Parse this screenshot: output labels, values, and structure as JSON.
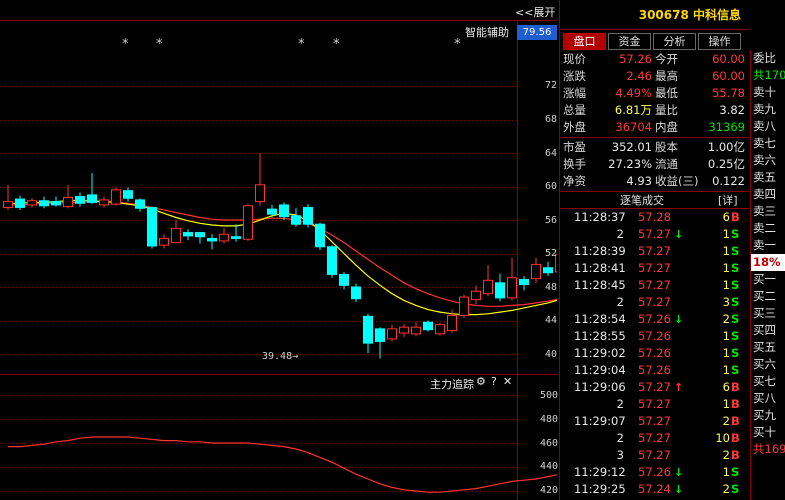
{
  "chart": {
    "collapse_link": "<<展开",
    "smart_label": "智能辅助",
    "current_price_tag": "79.56",
    "y_labels": [
      "72",
      "68",
      "64",
      "60",
      "56",
      "52",
      "48",
      "44",
      "40"
    ],
    "low_marker": "39.48→",
    "sub_title": "主力追踪",
    "sub_gear_icon": "⚙",
    "sub_help_icon": "?",
    "sub_close_icon": "✕",
    "sub_y_labels": [
      "500",
      "480",
      "460",
      "440",
      "420"
    ],
    "star_glyph": "*",
    "colors": {
      "up": "#ff3232",
      "down": "#00ffff",
      "ma_yellow": "#ffff00",
      "ma_red": "#ff3232",
      "grid": "#8b0000"
    }
  },
  "chart_data": {
    "type": "candlestick",
    "ylim": [
      38,
      76
    ],
    "candles": [
      {
        "o": 57.5,
        "c": 58.2,
        "h": 60.2,
        "l": 57.2
      },
      {
        "o": 58.5,
        "c": 57.5,
        "h": 58.9,
        "l": 57.2
      },
      {
        "o": 57.8,
        "c": 58.3,
        "h": 58.6,
        "l": 57.5
      },
      {
        "o": 58.3,
        "c": 57.7,
        "h": 58.8,
        "l": 57.4
      },
      {
        "o": 58.2,
        "c": 57.8,
        "h": 58.8,
        "l": 57.6
      },
      {
        "o": 57.6,
        "c": 58.7,
        "h": 60.2,
        "l": 57.4
      },
      {
        "o": 58.8,
        "c": 58.0,
        "h": 59.3,
        "l": 57.6
      },
      {
        "o": 59.0,
        "c": 58.1,
        "h": 61.6,
        "l": 57.9
      },
      {
        "o": 57.8,
        "c": 58.4,
        "h": 58.8,
        "l": 57.5
      },
      {
        "o": 57.9,
        "c": 59.6,
        "h": 59.9,
        "l": 57.7
      },
      {
        "o": 59.5,
        "c": 58.6,
        "h": 59.9,
        "l": 58.2
      },
      {
        "o": 58.4,
        "c": 57.4,
        "h": 58.6,
        "l": 57.0
      },
      {
        "o": 57.5,
        "c": 52.9,
        "h": 57.6,
        "l": 52.6
      },
      {
        "o": 53.0,
        "c": 53.8,
        "h": 54.3,
        "l": 52.6
      },
      {
        "o": 53.3,
        "c": 55.0,
        "h": 56.0,
        "l": 53.2
      },
      {
        "o": 54.5,
        "c": 54.1,
        "h": 54.9,
        "l": 53.6
      },
      {
        "o": 54.5,
        "c": 54.0,
        "h": 54.6,
        "l": 53.2
      },
      {
        "o": 53.8,
        "c": 53.5,
        "h": 54.3,
        "l": 52.5
      },
      {
        "o": 53.5,
        "c": 54.3,
        "h": 55.0,
        "l": 53.2
      },
      {
        "o": 54.0,
        "c": 53.8,
        "h": 55.5,
        "l": 53.4
      },
      {
        "o": 53.7,
        "c": 57.7,
        "h": 57.9,
        "l": 53.5
      },
      {
        "o": 58.2,
        "c": 60.2,
        "h": 64.0,
        "l": 57.7
      },
      {
        "o": 57.3,
        "c": 56.7,
        "h": 57.8,
        "l": 56.3
      },
      {
        "o": 57.8,
        "c": 56.4,
        "h": 58.1,
        "l": 56.0
      },
      {
        "o": 56.5,
        "c": 55.5,
        "h": 57.4,
        "l": 55.2
      },
      {
        "o": 57.5,
        "c": 55.5,
        "h": 57.9,
        "l": 55.1
      },
      {
        "o": 55.5,
        "c": 52.8,
        "h": 55.7,
        "l": 52.4
      },
      {
        "o": 52.8,
        "c": 49.5,
        "h": 53.0,
        "l": 49.1
      },
      {
        "o": 49.5,
        "c": 48.2,
        "h": 49.8,
        "l": 47.7
      },
      {
        "o": 48.0,
        "c": 46.6,
        "h": 48.4,
        "l": 46.2
      },
      {
        "o": 44.5,
        "c": 41.3,
        "h": 44.8,
        "l": 40.1
      },
      {
        "o": 43.0,
        "c": 41.5,
        "h": 43.2,
        "l": 39.48
      },
      {
        "o": 41.8,
        "c": 43.0,
        "h": 43.5,
        "l": 41.5
      },
      {
        "o": 42.5,
        "c": 43.2,
        "h": 43.6,
        "l": 42.0
      },
      {
        "o": 42.4,
        "c": 43.2,
        "h": 43.8,
        "l": 42.1
      },
      {
        "o": 43.8,
        "c": 42.9,
        "h": 44.0,
        "l": 42.7
      },
      {
        "o": 42.4,
        "c": 43.5,
        "h": 43.7,
        "l": 42.2
      },
      {
        "o": 42.8,
        "c": 44.6,
        "h": 45.3,
        "l": 42.5
      },
      {
        "o": 44.6,
        "c": 46.8,
        "h": 47.1,
        "l": 44.3
      },
      {
        "o": 46.5,
        "c": 47.5,
        "h": 48.2,
        "l": 46.0
      },
      {
        "o": 47.2,
        "c": 48.8,
        "h": 50.6,
        "l": 46.9
      },
      {
        "o": 48.5,
        "c": 46.7,
        "h": 49.6,
        "l": 46.3
      },
      {
        "o": 46.7,
        "c": 49.1,
        "h": 51.5,
        "l": 46.4
      },
      {
        "o": 48.9,
        "c": 48.3,
        "h": 49.3,
        "l": 47.6
      },
      {
        "o": 49.0,
        "c": 50.7,
        "h": 51.5,
        "l": 48.5
      },
      {
        "o": 50.3,
        "c": 49.7,
        "h": 51.0,
        "l": 49.3
      },
      {
        "o": 49.8,
        "c": 51.9,
        "h": 52.2,
        "l": 49.5
      },
      {
        "o": 51.3,
        "c": 50.0,
        "h": 53.2,
        "l": 47.9
      },
      {
        "o": 50.5,
        "c": 55.3,
        "h": 55.5,
        "l": 50.2
      },
      {
        "o": 57.3,
        "c": 60.3,
        "h": 60.8,
        "l": 56.4
      }
    ],
    "ma_yellow": [
      58.0,
      58.0,
      58.1,
      58.1,
      58.2,
      58.3,
      58.3,
      58.3,
      58.2,
      58.1,
      57.9,
      57.7,
      57.3,
      56.8,
      56.3,
      55.9,
      55.6,
      55.4,
      55.3,
      55.3,
      55.5,
      56.0,
      56.5,
      56.8,
      56.6,
      55.9,
      54.8,
      53.4,
      52.0,
      50.6,
      49.3,
      48.2,
      47.2,
      46.4,
      45.8,
      45.3,
      45.0,
      44.8,
      44.7,
      44.7,
      44.8,
      45.0,
      45.2,
      45.5,
      45.8,
      46.1,
      46.5,
      47.0,
      47.6,
      48.4
    ],
    "ma_red": [
      57.8,
      57.8,
      57.9,
      58.0,
      58.0,
      58.1,
      58.1,
      58.2,
      58.2,
      58.1,
      58.0,
      57.8,
      57.5,
      57.2,
      56.9,
      56.6,
      56.3,
      56.1,
      56.0,
      56.0,
      56.0,
      56.1,
      56.2,
      56.2,
      56.0,
      55.6,
      55.0,
      54.2,
      53.3,
      52.3,
      51.3,
      50.3,
      49.4,
      48.5,
      47.8,
      47.2,
      46.7,
      46.3,
      46.0,
      45.8,
      45.7,
      45.7,
      45.8,
      45.9,
      46.1,
      46.3,
      46.6,
      46.9,
      47.3,
      47.8
    ],
    "sub_ylim": [
      418,
      502
    ],
    "sub_series": [
      457,
      457,
      458,
      459,
      461,
      462,
      464,
      465,
      465,
      465,
      465,
      464,
      463,
      462,
      462,
      461,
      461,
      460,
      460,
      460,
      460,
      459,
      458,
      457,
      455,
      452,
      448,
      444,
      439,
      434,
      430,
      426,
      423,
      421,
      420,
      419,
      419,
      420,
      421,
      422,
      424,
      426,
      428,
      429,
      430,
      432,
      434,
      436,
      439,
      442
    ]
  },
  "quote": {
    "header": "300678 中科信息",
    "tabs": [
      "盘口",
      "资金",
      "分析",
      "操作"
    ],
    "rows": [
      [
        {
          "t": "现价",
          "c": "lab"
        },
        {
          "t": "57.26",
          "c": "val-red"
        },
        {
          "t": "今开",
          "c": "lab"
        },
        {
          "t": "60.00",
          "c": "val-red"
        }
      ],
      [
        {
          "t": "涨跌",
          "c": "lab"
        },
        {
          "t": "2.46",
          "c": "val-red"
        },
        {
          "t": "最高",
          "c": "lab"
        },
        {
          "t": "60.00",
          "c": "val-red"
        }
      ],
      [
        {
          "t": "涨幅",
          "c": "lab"
        },
        {
          "t": "4.49%",
          "c": "val-red"
        },
        {
          "t": "最低",
          "c": "lab"
        },
        {
          "t": "55.78",
          "c": "val-red"
        }
      ],
      [
        {
          "t": "总量",
          "c": "lab"
        },
        {
          "t": "6.81万",
          "c": "val-yellow"
        },
        {
          "t": "量比",
          "c": "lab"
        },
        {
          "t": "3.82",
          "c": "val-white"
        }
      ],
      [
        {
          "t": "外盘",
          "c": "lab"
        },
        {
          "t": "36704",
          "c": "val-red"
        },
        {
          "t": "内盘",
          "c": "lab"
        },
        {
          "t": "31369",
          "c": "val-green"
        }
      ]
    ],
    "rows2": [
      [
        {
          "t": "市盈",
          "c": "lab"
        },
        {
          "t": "352.01",
          "c": "val-white"
        },
        {
          "t": "股本",
          "c": "lab"
        },
        {
          "t": "1.00亿",
          "c": "val-white"
        }
      ],
      [
        {
          "t": "换手",
          "c": "lab"
        },
        {
          "t": "27.23%",
          "c": "val-white"
        },
        {
          "t": "流通",
          "c": "lab"
        },
        {
          "t": "0.25亿",
          "c": "val-white"
        }
      ],
      [
        {
          "t": "净资",
          "c": "lab"
        },
        {
          "t": "4.93",
          "c": "val-white"
        },
        {
          "t": "收益(三)",
          "c": "lab"
        },
        {
          "t": "0.122",
          "c": "val-white"
        }
      ]
    ],
    "trade_title": "逐笔成交",
    "trade_detail": "[详]",
    "trades": [
      {
        "time": "11:28:37",
        "price": "57.28",
        "arrow": "",
        "vol": "6",
        "side": "B"
      },
      {
        "time": "2",
        "price": "57.27",
        "arrow": "↓",
        "vol": "1",
        "side": "S"
      },
      {
        "time": "11:28:39",
        "price": "57.27",
        "arrow": "",
        "vol": "1",
        "side": "S"
      },
      {
        "time": "11:28:41",
        "price": "57.27",
        "arrow": "",
        "vol": "1",
        "side": "S"
      },
      {
        "time": "11:28:45",
        "price": "57.27",
        "arrow": "",
        "vol": "1",
        "side": "S"
      },
      {
        "time": "2",
        "price": "57.27",
        "arrow": "",
        "vol": "3",
        "side": "S"
      },
      {
        "time": "11:28:54",
        "price": "57.26",
        "arrow": "↓",
        "vol": "2",
        "side": "S"
      },
      {
        "time": "11:28:55",
        "price": "57.26",
        "arrow": "",
        "vol": "1",
        "side": "S"
      },
      {
        "time": "11:29:02",
        "price": "57.26",
        "arrow": "",
        "vol": "1",
        "side": "S"
      },
      {
        "time": "11:29:04",
        "price": "57.26",
        "arrow": "",
        "vol": "1",
        "side": "S"
      },
      {
        "time": "11:29:06",
        "price": "57.27",
        "arrow": "↑",
        "vol": "6",
        "side": "B"
      },
      {
        "time": "2",
        "price": "57.27",
        "arrow": "",
        "vol": "1",
        "side": "B"
      },
      {
        "time": "11:29:07",
        "price": "57.27",
        "arrow": "",
        "vol": "2",
        "side": "B"
      },
      {
        "time": "2",
        "price": "57.27",
        "arrow": "",
        "vol": "10",
        "side": "B"
      },
      {
        "time": "3",
        "price": "57.27",
        "arrow": "",
        "vol": "2",
        "side": "B"
      },
      {
        "time": "11:29:12",
        "price": "57.26",
        "arrow": "↓",
        "vol": "1",
        "side": "S"
      },
      {
        "time": "11:29:25",
        "price": "57.24",
        "arrow": "↓",
        "vol": "2",
        "side": "S"
      }
    ]
  },
  "book": {
    "rows": [
      {
        "t": "委比",
        "c": "hdr"
      },
      {
        "t": "共170",
        "c": "green"
      },
      {
        "t": "卖十",
        "c": "hdr"
      },
      {
        "t": "卖九",
        "c": "hdr"
      },
      {
        "t": "卖八",
        "c": "hdr"
      },
      {
        "t": "卖七",
        "c": "hdr"
      },
      {
        "t": "卖六",
        "c": "hdr"
      },
      {
        "t": "卖五",
        "c": "hdr"
      },
      {
        "t": "卖四",
        "c": "hdr"
      },
      {
        "t": "卖三",
        "c": "hdr"
      },
      {
        "t": "卖二",
        "c": "hdr"
      },
      {
        "t": "卖一",
        "c": "hdr"
      },
      {
        "t": "18%",
        "c": "badge"
      },
      {
        "t": "买一",
        "c": "hdr"
      },
      {
        "t": "买二",
        "c": "hdr"
      },
      {
        "t": "买三",
        "c": "hdr"
      },
      {
        "t": "买四",
        "c": "hdr"
      },
      {
        "t": "买五",
        "c": "hdr"
      },
      {
        "t": "买六",
        "c": "hdr"
      },
      {
        "t": "买七",
        "c": "hdr"
      },
      {
        "t": "买八",
        "c": "hdr"
      },
      {
        "t": "买九",
        "c": "hdr"
      },
      {
        "t": "买十",
        "c": "hdr"
      },
      {
        "t": "共169",
        "c": "red"
      }
    ]
  }
}
